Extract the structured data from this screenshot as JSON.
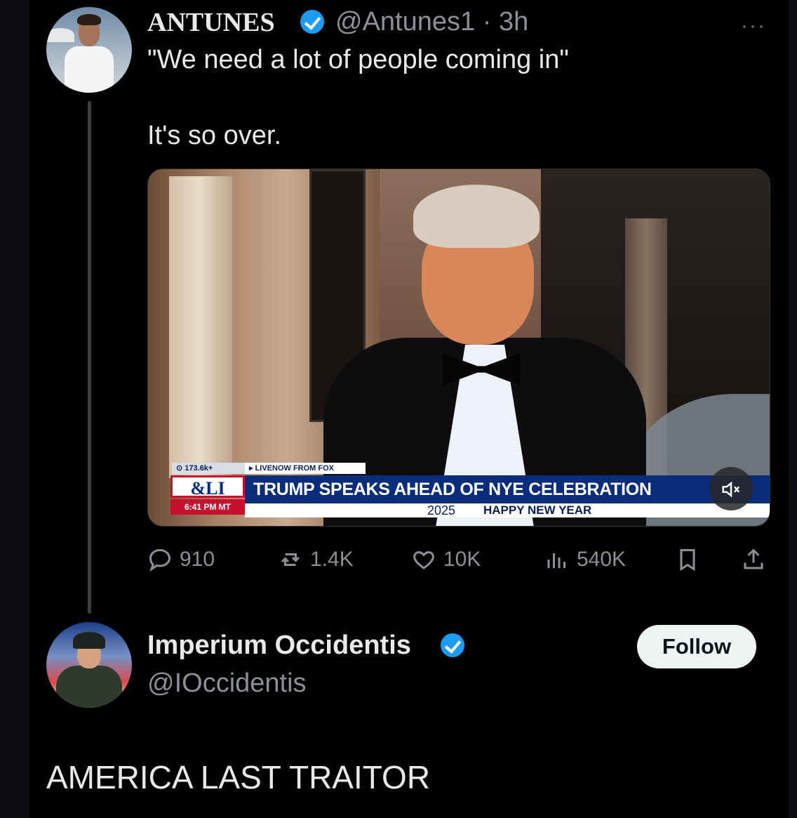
{
  "tweet_top": {
    "display_name": "ANTUNES",
    "handle": "@Antunes1",
    "separator": " · ",
    "time": "3h",
    "more_label": "···",
    "text_line1": "\"We need a lot of people coming in\"",
    "text_line2": "It's so over."
  },
  "media": {
    "views_tag": "⊙ 173.6k+",
    "live_tag": "▸ LIVENOW FROM FOX",
    "logo": "&LI",
    "time": "6:41 PM MT",
    "headline": "TRUMP SPEAKS AHEAD OF NYE CELEBRATION",
    "year": "2025",
    "sub": "HAPPY NEW YEAR",
    "mute_icon": "muted-speaker-icon"
  },
  "actions": {
    "replies": "910",
    "reposts": "1.4K",
    "likes": "10K",
    "views": "540K"
  },
  "tweet_reply": {
    "display_name": "Imperium Occidentis",
    "handle": "@IOccidentis",
    "follow_label": "Follow",
    "text": "AMERICA LAST TRAITOR"
  },
  "colors": {
    "background": "#000000",
    "verified": "#1d9bf0",
    "muted_text": "#8b9096",
    "news_blue": "#0b2c78",
    "news_red": "#c6102e"
  }
}
